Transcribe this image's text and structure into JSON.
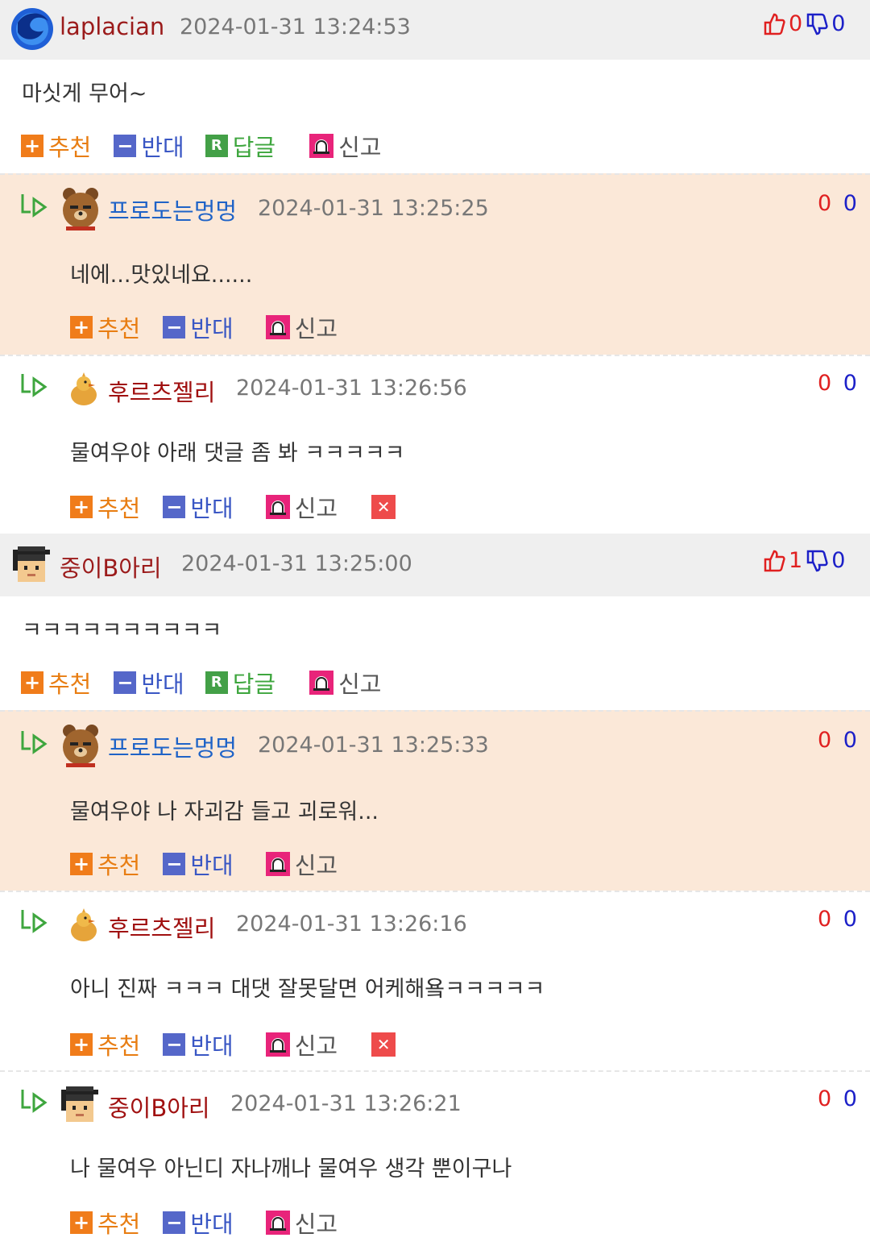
{
  "labels": {
    "recommend": "추천",
    "oppose": "반대",
    "reply": "답글",
    "report": "신고"
  },
  "comments": [
    {
      "nick": "laplacian",
      "date": "2024-01-31 13:24:53",
      "text": "마싯게 무어~",
      "up": "0",
      "down": "0",
      "avatar": "firefox-logo"
    },
    {
      "nick": "프로도는멍멍",
      "date": "2024-01-31 13:25:25",
      "text": "네에...맛있네요......",
      "up": "0",
      "down": "0",
      "avatar": "bear"
    },
    {
      "nick": "후르츠젤리",
      "date": "2024-01-31 13:26:56",
      "text": "물여우야 아래 댓글 좀 봐 ㅋㅋㅋㅋㅋ",
      "up": "0",
      "down": "0",
      "avatar": "chick"
    },
    {
      "nick": "중이B아리",
      "date": "2024-01-31 13:25:00",
      "text": "ㅋㅋㅋㅋㅋㅋㅋㅋㅋㅋ",
      "up": "1",
      "down": "0",
      "avatar": "pixel-student"
    },
    {
      "nick": "프로도는멍멍",
      "date": "2024-01-31 13:25:33",
      "text": "물여우야 나 자괴감 들고 괴로워...",
      "up": "0",
      "down": "0",
      "avatar": "bear"
    },
    {
      "nick": "후르츠젤리",
      "date": "2024-01-31 13:26:16",
      "text": "아니 진짜 ㅋㅋㅋ 대댓 잘못달면 어케해욬ㅋㅋㅋㅋㅋ",
      "up": "0",
      "down": "0",
      "avatar": "chick"
    },
    {
      "nick": "중이B아리",
      "date": "2024-01-31 13:26:21",
      "text": "나 물여우 아닌디 자나깨나 물여우 생각 뿐이구나",
      "up": "0",
      "down": "0",
      "avatar": "pixel-student"
    }
  ],
  "colors": {
    "nick_top": "#9b1b1b",
    "nick_blue": "#1f63c7",
    "nick_reply": "#a01010",
    "header_bg": "#efefef",
    "reply_bg": "#fbe8d8"
  }
}
